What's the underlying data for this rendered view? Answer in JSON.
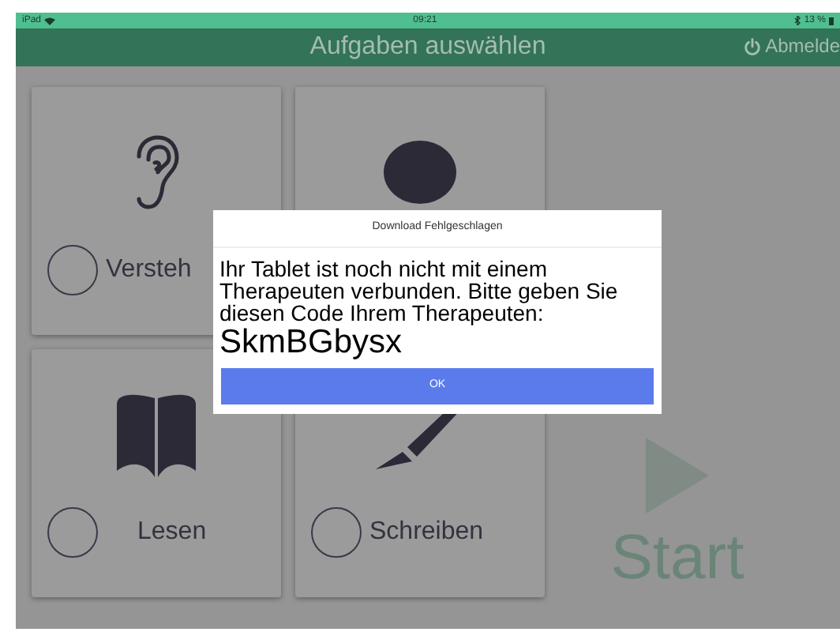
{
  "status_bar": {
    "device": "iPad",
    "time": "09:21",
    "battery": "13 %"
  },
  "header": {
    "title": "Aufgaben auswählen",
    "logout": "Abmelde"
  },
  "tasks": [
    {
      "kind": "ear",
      "label": "Versteh",
      "selected": false
    },
    {
      "kind": "blob"
    },
    {
      "kind": "book",
      "label": "Lesen",
      "selected": false
    },
    {
      "kind": "pencil",
      "label": "Schreiben",
      "selected": false
    }
  ],
  "start": {
    "label": "Start"
  },
  "dialog": {
    "title": "Download Fehlgeschlagen",
    "message": "Ihr Tablet ist noch nicht mit einem Therapeuten verbunden. Bitte geben Sie diesen Code Ihrem Therapeuten:",
    "code": "SkmBGbysx",
    "button": "OK"
  }
}
